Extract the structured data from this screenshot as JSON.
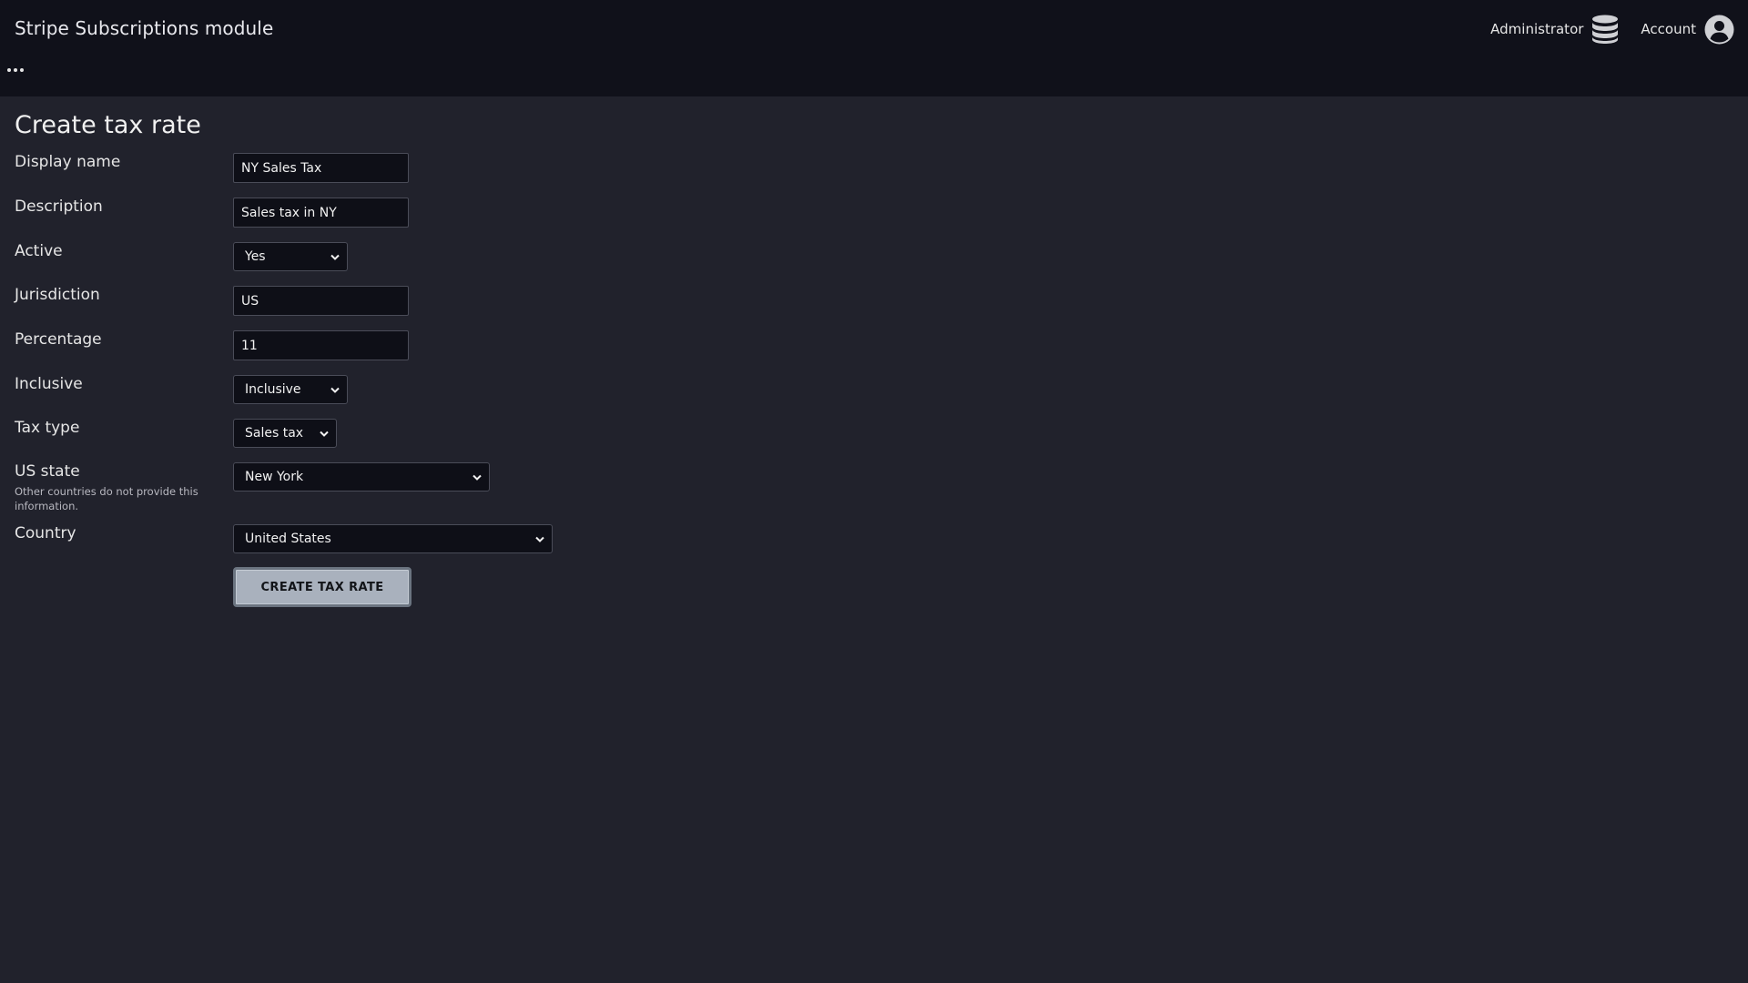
{
  "header": {
    "app_title": "Stripe Subscriptions module",
    "admin_label": "Administrator",
    "admin_icon": "database-icon",
    "account_label": "Account",
    "account_icon": "user-circle-icon",
    "menu_icon": "ellipsis-icon"
  },
  "page": {
    "title": "Create tax rate"
  },
  "form": {
    "display_name": {
      "label": "Display name",
      "value": "NY Sales Tax"
    },
    "description": {
      "label": "Description",
      "value": "Sales tax in NY"
    },
    "active": {
      "label": "Active",
      "selected": "Yes"
    },
    "jurisdiction": {
      "label": "Jurisdiction",
      "value": "US"
    },
    "percentage": {
      "label": "Percentage",
      "value": "11"
    },
    "inclusive": {
      "label": "Inclusive",
      "selected": "Inclusive"
    },
    "tax_type": {
      "label": "Tax type",
      "selected": "Sales tax"
    },
    "us_state": {
      "label": "US state",
      "help": "Other countries do not provide this information.",
      "selected": "New York"
    },
    "country": {
      "label": "Country",
      "selected": "United States"
    },
    "submit_label": "Create tax rate"
  },
  "colors": {
    "background": "#21222c",
    "header_background": "#10111a",
    "input_background": "#0e0f17",
    "button_background": "#a9b1bd"
  }
}
